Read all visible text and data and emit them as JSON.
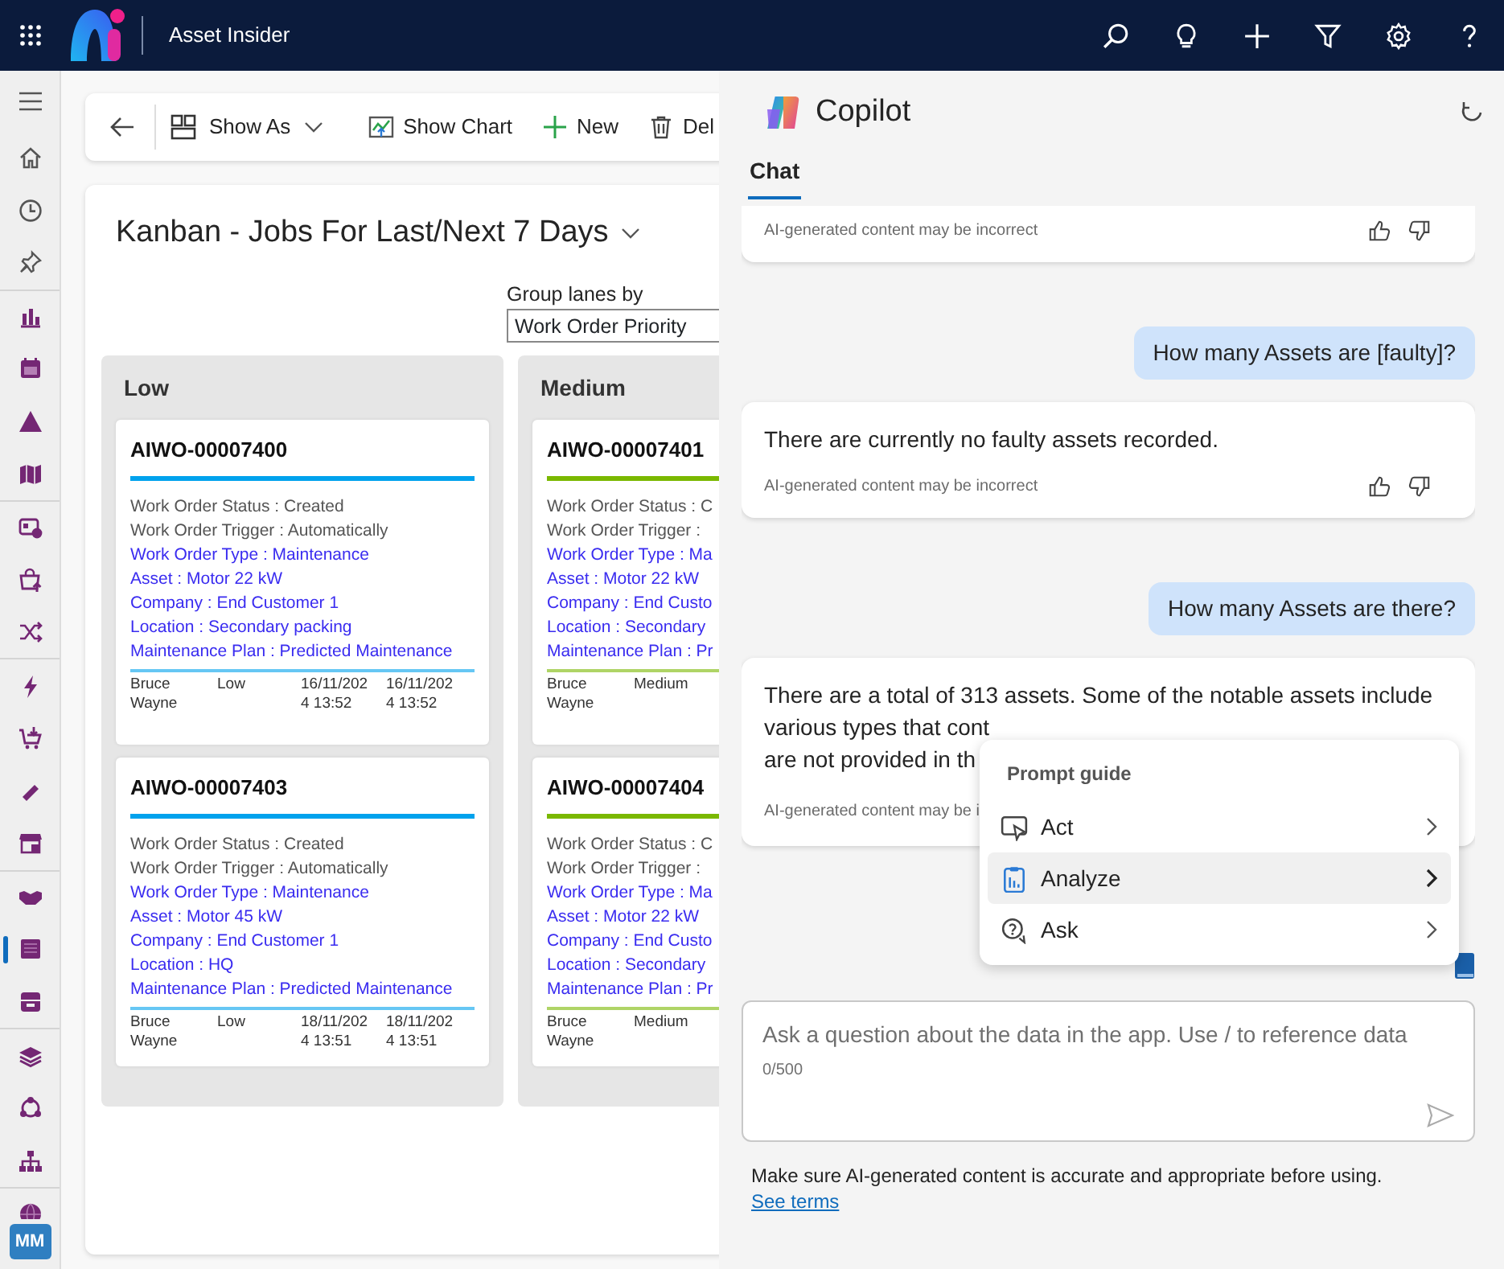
{
  "app": {
    "title": "Asset Insider"
  },
  "top_actions": [
    {
      "kind": "search"
    },
    {
      "kind": "idea"
    },
    {
      "kind": "add"
    },
    {
      "kind": "filter"
    },
    {
      "kind": "settings"
    },
    {
      "kind": "help"
    }
  ],
  "sidebar": {
    "groups": [
      {
        "items": [
          {
            "selected": false
          },
          {
            "selected": false
          },
          {
            "selected": false
          }
        ]
      },
      {
        "items": [
          {
            "selected": false
          },
          {
            "selected": false
          },
          {
            "selected": false
          },
          {
            "selected": false
          }
        ]
      },
      {
        "items": [
          {
            "selected": false
          },
          {
            "selected": false
          },
          {
            "selected": false
          }
        ]
      },
      {
        "items": [
          {
            "selected": false
          },
          {
            "selected": false
          },
          {
            "selected": false
          },
          {
            "selected": false
          }
        ]
      },
      {
        "items": [
          {
            "selected": false
          },
          {
            "selected": true
          },
          {
            "selected": false
          }
        ]
      },
      {
        "items": [
          {
            "selected": false
          },
          {
            "selected": false
          },
          {
            "selected": false
          }
        ]
      },
      {
        "items": [
          {
            "selected": false
          }
        ]
      }
    ],
    "avatar": "MM"
  },
  "toolbar": {
    "buttons": [
      {
        "kind": "show-as",
        "label": "Show As"
      },
      {
        "kind": "chart",
        "label": "Show Chart"
      },
      {
        "kind": "new",
        "label": "New"
      },
      {
        "kind": "delete",
        "label": "Del"
      }
    ]
  },
  "view": {
    "title": "Kanban - Jobs For Last/Next 7 Days",
    "group_by": {
      "label": "Group lanes by",
      "value": "Work Order Priority"
    }
  },
  "lanes": [
    {
      "name": "Low",
      "color": "#00a2ed",
      "cards": [
        {
          "id": "AIWO-00007400",
          "fields": [
            {
              "text": "Work Order Status : Created",
              "linked": false
            },
            {
              "text": "Work Order Trigger : Automatically",
              "linked": false
            },
            {
              "text": "Work Order Type : Maintenance",
              "linked": true
            },
            {
              "text": "Asset : Motor 22 kW",
              "linked": true
            },
            {
              "text": "Company : End Customer 1",
              "linked": true
            },
            {
              "text": "Location : Secondary packing",
              "linked": true
            },
            {
              "text": "Maintenance Plan : Predicted Maintenance",
              "linked": true
            }
          ],
          "footer": [
            "Bruce Wayne",
            "Low",
            "16/11/2024 13:52",
            "16/11/2024 13:52"
          ]
        },
        {
          "id": "AIWO-00007403",
          "fields": [
            {
              "text": "Work Order Status : Created",
              "linked": false
            },
            {
              "text": "Work Order Trigger : Automatically",
              "linked": false
            },
            {
              "text": "Work Order Type : Maintenance",
              "linked": true
            },
            {
              "text": "Asset : Motor 45 kW",
              "linked": true
            },
            {
              "text": "Company : End Customer 1",
              "linked": true
            },
            {
              "text": "Location : HQ",
              "linked": true
            },
            {
              "text": "Maintenance Plan : Predicted Maintenance",
              "linked": true
            }
          ],
          "footer": [
            "Bruce Wayne",
            "Low",
            "18/11/2024 13:51",
            "18/11/2024 13:51"
          ]
        }
      ]
    },
    {
      "name": "Medium",
      "color": "#7ab800",
      "cards": [
        {
          "id": "AIWO-00007401",
          "fields": [
            {
              "text": "Work Order Status : C",
              "linked": false
            },
            {
              "text": "Work Order Trigger :",
              "linked": false
            },
            {
              "text": "Work Order Type : Ma",
              "linked": true
            },
            {
              "text": "Asset : Motor 22 kW",
              "linked": true
            },
            {
              "text": "Company : End Custo",
              "linked": true
            },
            {
              "text": "Location : Secondary",
              "linked": true
            },
            {
              "text": "Maintenance Plan : Pr",
              "linked": true
            }
          ],
          "footer": [
            "Bruce Wayne",
            "Medium"
          ]
        },
        {
          "id": "AIWO-00007404",
          "fields": [
            {
              "text": "Work Order Status : C",
              "linked": false
            },
            {
              "text": "Work Order Trigger :",
              "linked": false
            },
            {
              "text": "Work Order Type : Ma",
              "linked": true
            },
            {
              "text": "Asset : Motor 22 kW",
              "linked": true
            },
            {
              "text": "Company : End Custo",
              "linked": true
            },
            {
              "text": "Location : Secondary",
              "linked": true
            },
            {
              "text": "Maintenance Plan : Pr",
              "linked": true
            }
          ],
          "footer": [
            "Bruce Wayne",
            "Medium"
          ]
        }
      ]
    }
  ],
  "copilot": {
    "title": "Copilot",
    "tabs": [
      {
        "label": "Chat",
        "selected": true
      }
    ],
    "messages": [
      {
        "kind": "response",
        "disclaimer": "AI-generated content may be incorrect",
        "feedback": true
      },
      {
        "kind": "question",
        "lines": [
          "How many Assets are [faulty]?"
        ]
      },
      {
        "kind": "response",
        "lines": [
          "There are currently no faulty assets recorded."
        ],
        "disclaimer": "AI-generated content may be incorrect",
        "feedback": true
      },
      {
        "kind": "question",
        "lines": [
          "How many Assets are there?"
        ]
      },
      {
        "kind": "response",
        "lines": [
          "There are a total of 313 assets. Some of the notable assets include",
          "various types that cont",
          "are not provided in th"
        ],
        "disclaimer": "AI-generated content may be i",
        "feedback": false
      }
    ],
    "prompt_guide": {
      "title": "Prompt guide",
      "items": [
        {
          "kind": "act",
          "label": "Act",
          "selected": false
        },
        {
          "kind": "analyze",
          "label": "Analyze",
          "selected": true
        },
        {
          "kind": "ask",
          "label": "Ask",
          "selected": false
        }
      ]
    },
    "input": {
      "placeholder": "Ask a question about the data in the app. Use / to reference data",
      "counter": "0/500"
    },
    "footer": {
      "text": "Make sure AI-generated content is accurate and appropriate before using.",
      "link": "See terms"
    }
  }
}
